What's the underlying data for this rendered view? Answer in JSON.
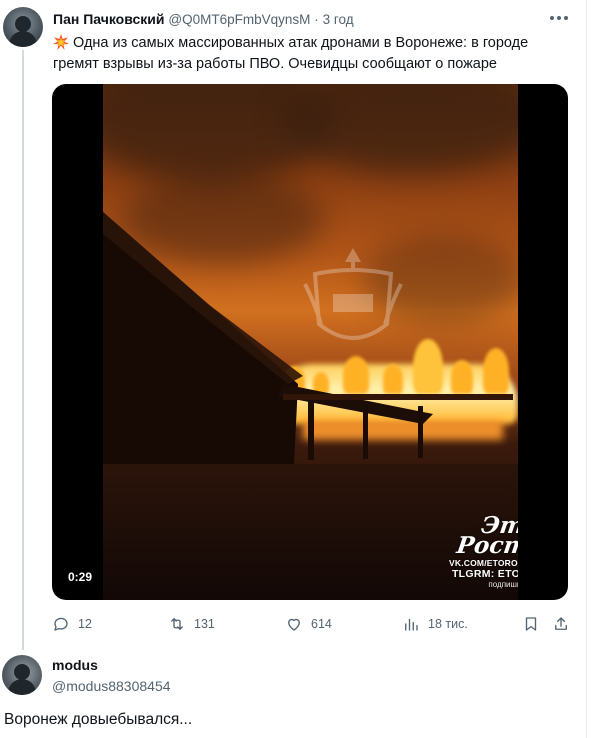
{
  "tweet": {
    "author_name": "Пан Пачковский",
    "handle": "@Q0MT6pFmbVqynsM",
    "separator": "·",
    "time": "3 год",
    "emoji_icon": "collision-icon",
    "text": "Одна из самых массированных атак дронами в  Воронеже: в городе гремят взрывы из-за работы ПВО. Очевидцы сообщают о пожаре",
    "video": {
      "duration": "0:29",
      "watermark_logo": "Это Ростов",
      "watermark_url": "VK.COM/ETOROSTOVNADONU",
      "watermark_tg": "TLGRM: ETOROSTOV",
      "watermark_sub": "подпишись"
    },
    "actions": {
      "replies": "12",
      "retweets": "131",
      "likes": "614",
      "views": "18 тис."
    }
  },
  "reply": {
    "author_name": "modus",
    "handle": "@modus88308454",
    "text": "Воронеж довыебывался..."
  },
  "colors": {
    "text_primary": "#0f1419",
    "text_secondary": "#536471",
    "thread_line": "#cfd9de"
  }
}
